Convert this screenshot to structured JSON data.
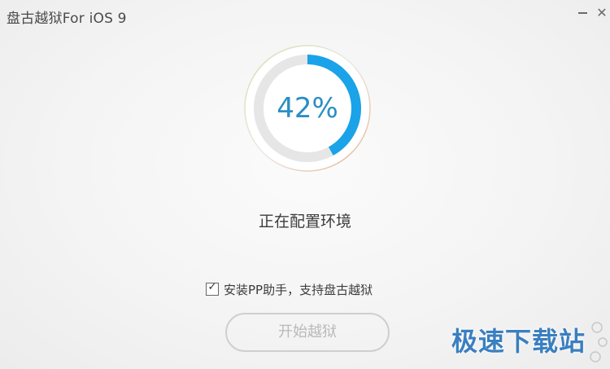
{
  "window": {
    "title": "盘古越狱For iOS 9",
    "minimize_icon": "minimize-icon",
    "close_icon": "close-icon",
    "close_glyph": "✕"
  },
  "progress": {
    "percent_label": "42%",
    "value": 0.42,
    "track_color": "#e6e6e6",
    "fill_color": "#1aa3e8",
    "text_color": "#2a8ec4"
  },
  "status": {
    "text": "正在配置环境"
  },
  "options": {
    "install_pp_label": "安装PP助手，支持盘古越狱",
    "install_pp_checked": true,
    "check_glyph": "✓"
  },
  "actions": {
    "start_label": "开始越狱",
    "start_enabled": false
  },
  "watermark": {
    "text": "极速下载站"
  }
}
